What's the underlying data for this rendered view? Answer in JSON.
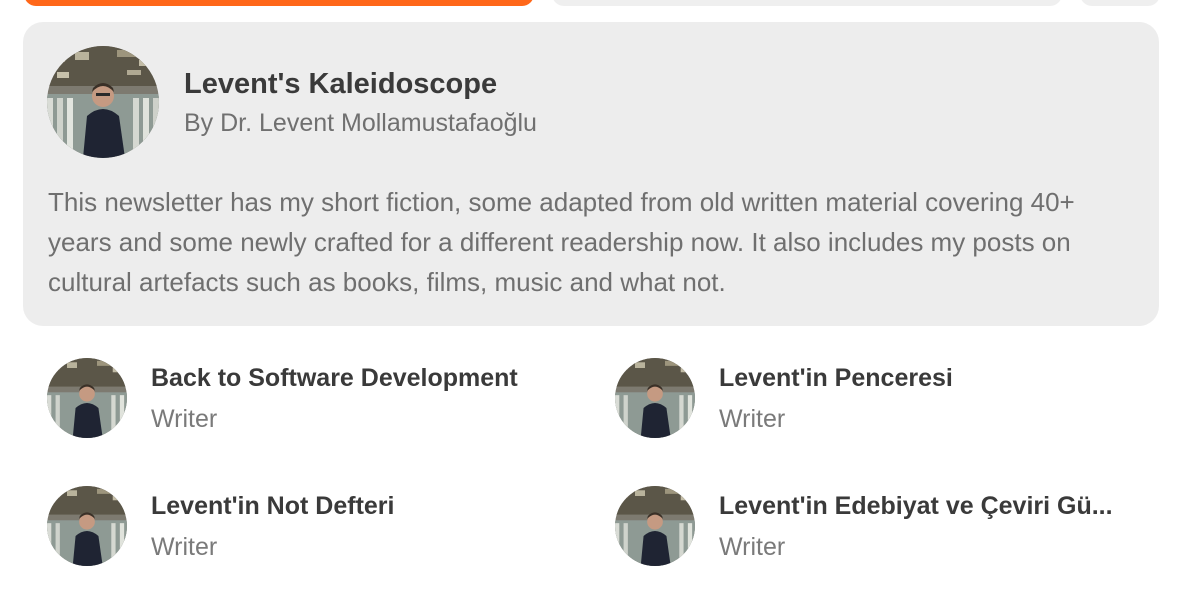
{
  "publication": {
    "title": "Levent's Kaleidoscope",
    "byline": "By Dr. Levent Mollamustafaoğlu",
    "description": "This newsletter has my short fiction, some adapted from old written material covering 40+ years and some newly crafted for a different readership now. It also includes my posts on cultural artefacts such as books, films, music and what not."
  },
  "writers": [
    {
      "name": "Back to Software Development",
      "role": "Writer"
    },
    {
      "name": "Levent'in Penceresi",
      "role": "Writer"
    },
    {
      "name": "Levent'in Not Defteri",
      "role": "Writer"
    },
    {
      "name": "Levent'in Edebiyat ve Çeviri Gü...",
      "role": "Writer"
    }
  ],
  "colors": {
    "accent": "#ff6719",
    "card_background": "#ededed"
  }
}
